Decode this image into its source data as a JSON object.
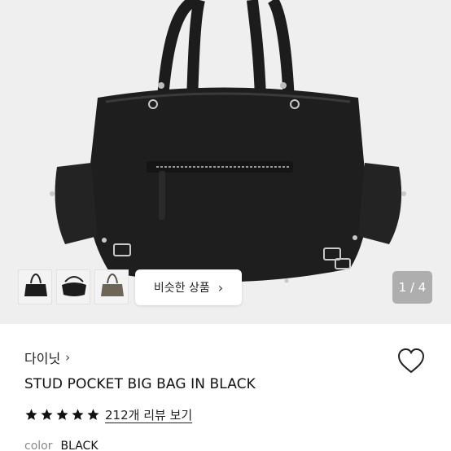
{
  "gallery": {
    "similar_button_label": "비슷한 상품",
    "page_counter": "1 / 4",
    "thumbnails": [
      "thumbnail-bag-1",
      "thumbnail-bag-2",
      "thumbnail-bag-3"
    ]
  },
  "product": {
    "brand": "다이닛",
    "title": "STUD POCKET BIG BAG IN BLACK",
    "rating_stars": 5,
    "reviews_label": "212개 리뷰 보기",
    "option_label": "color",
    "option_value": "BLACK"
  },
  "icons": {
    "brand_chevron": "chevron-right-icon",
    "similar_chevron": "chevron-right-icon",
    "wishlist": "heart-outline-icon",
    "star": "star-filled-icon"
  },
  "colors": {
    "star": "#111111",
    "counter_bg": "#888888"
  }
}
